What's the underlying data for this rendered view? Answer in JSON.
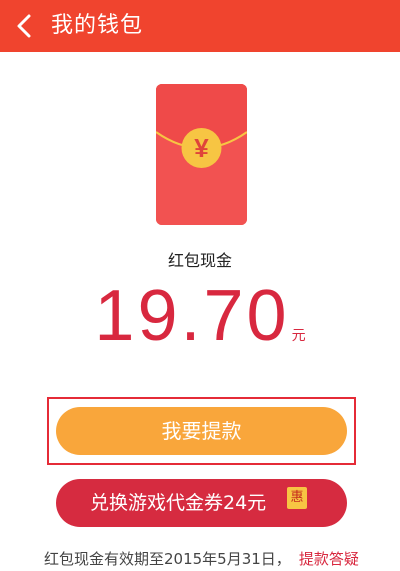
{
  "header": {
    "title": "我的钱包",
    "back_icon": "chevron-left-icon",
    "background": "#f0442e"
  },
  "envelope": {
    "icon": "red-envelope-icon",
    "symbol": "¥",
    "body_color": "#f25251",
    "coin_color": "#f7c543"
  },
  "balance": {
    "label": "红包现金",
    "amount": "19.70",
    "unit": "元",
    "color": "#d8283f"
  },
  "buttons": {
    "withdraw_label": "我要提款",
    "withdraw_color": "#f9a63b",
    "exchange_label": "兑换游戏代金券24元",
    "exchange_color": "#d62b40",
    "exchange_badge": "惠"
  },
  "footer": {
    "note": "红包现金有效期至2015年5月31日，",
    "link": "提款答疑"
  }
}
